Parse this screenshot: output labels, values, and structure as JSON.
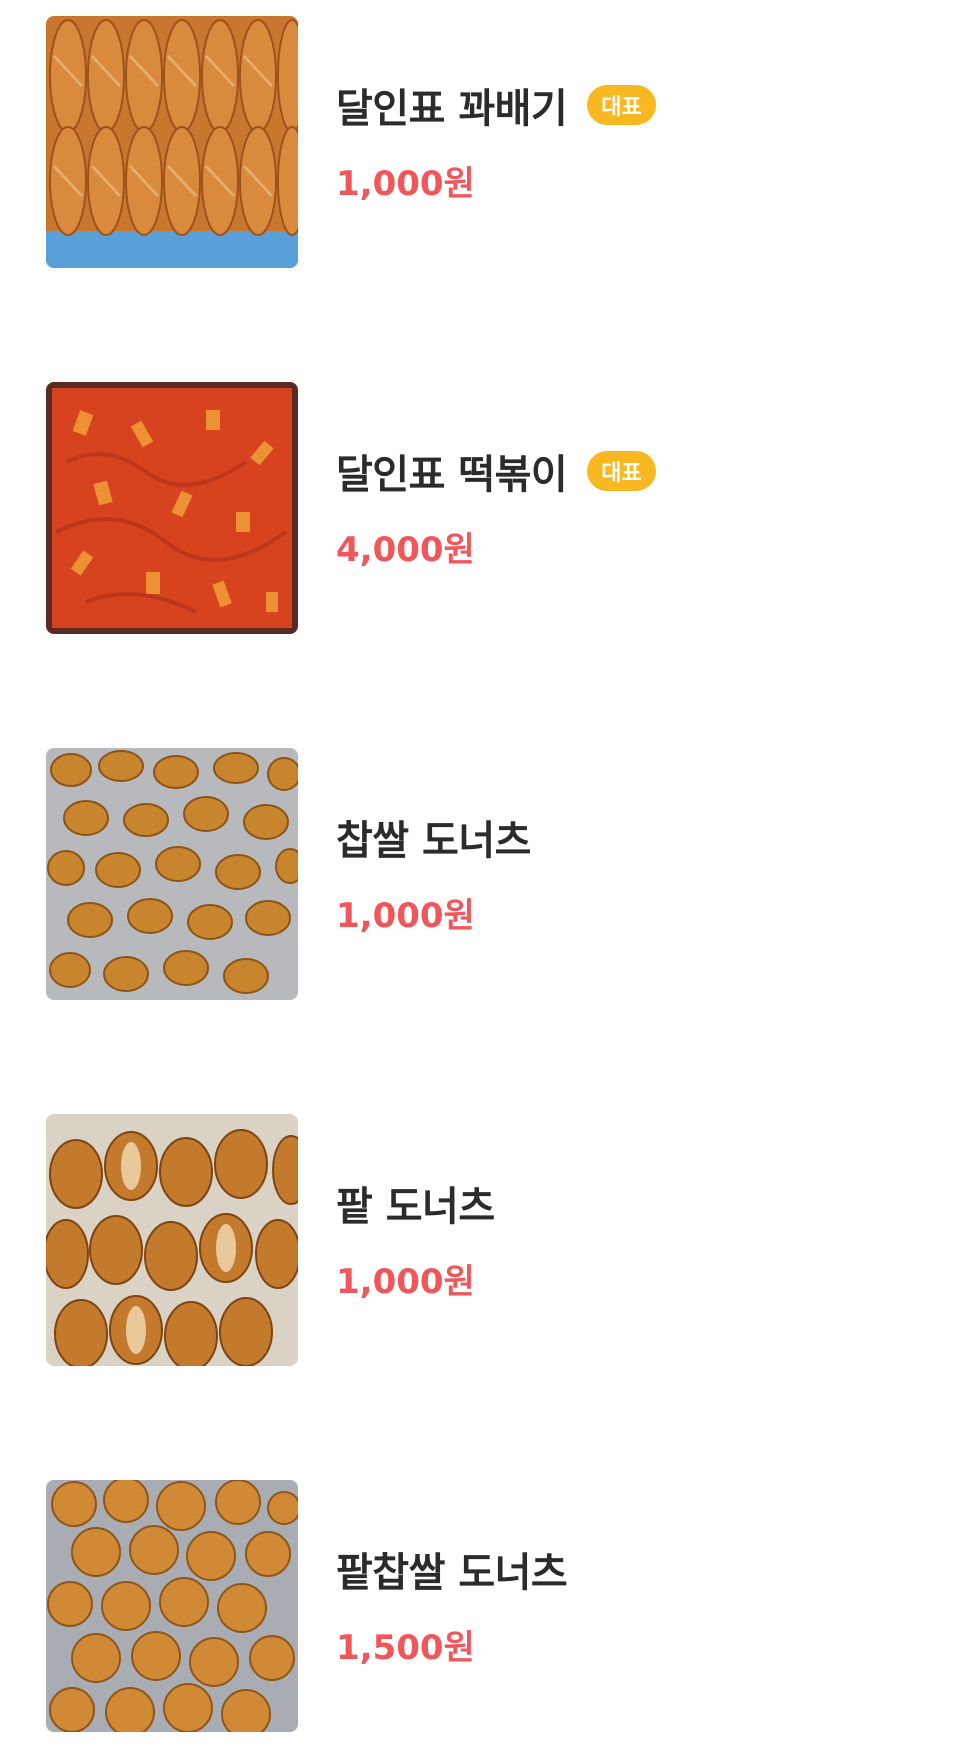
{
  "colors": {
    "name_text": "#2b2b2b",
    "price_text": "#f0575a",
    "badge_bg": "#f7b821",
    "badge_text": "#ffffff"
  },
  "menu": {
    "items": [
      {
        "name": "달인표 꽈배기",
        "badge": "대표",
        "price": "1,000원",
        "image": "twisted-donuts-photo"
      },
      {
        "name": "달인표 떡볶이",
        "badge": "대표",
        "price": "4,000원",
        "image": "tteokbokki-photo"
      },
      {
        "name": "찹쌀 도너츠",
        "price": "1,000원",
        "image": "glutinous-rice-donuts-photo"
      },
      {
        "name": "팥 도너츠",
        "price": "1,000원",
        "image": "red-bean-donuts-photo"
      },
      {
        "name": "팥찹쌀 도너츠",
        "price": "1,500원",
        "image": "red-bean-rice-donuts-photo"
      }
    ]
  }
}
